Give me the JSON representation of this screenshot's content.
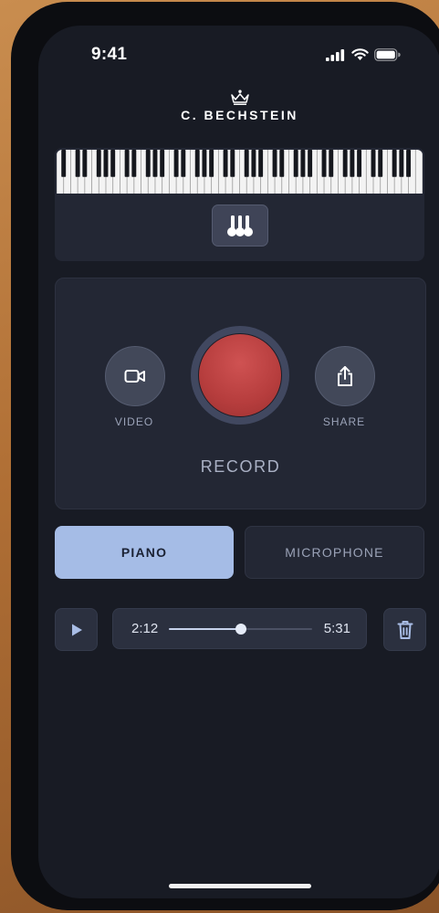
{
  "status_bar": {
    "time": "9:41",
    "icons": [
      "cellular-signal-icon",
      "wifi-icon",
      "battery-icon"
    ]
  },
  "brand": {
    "logo_icon": "crown-icon",
    "name": "C. BECHSTEIN"
  },
  "piano_panel": {
    "keyboard_icon": "piano-keyboard-icon",
    "toggle_icon": "piano-hammers-icon"
  },
  "record_panel": {
    "video": {
      "label": "VIDEO",
      "icon": "video-camera-icon"
    },
    "record": {
      "label": "RECORD",
      "color": "#c04444"
    },
    "share": {
      "label": "SHARE",
      "icon": "share-icon"
    }
  },
  "source_toggle": {
    "options": [
      {
        "label": "PIANO",
        "selected": true
      },
      {
        "label": "MICROPHONE",
        "selected": false
      }
    ],
    "accent": "#a5bce6"
  },
  "playback": {
    "play_icon": "play-icon",
    "current_time": "2:12",
    "total_time": "5:31",
    "progress": 0.5,
    "delete_icon": "trash-icon"
  }
}
